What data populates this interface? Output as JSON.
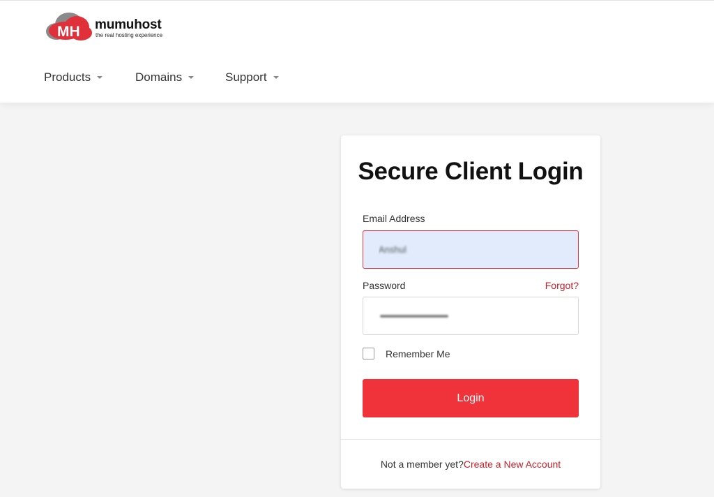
{
  "brand": {
    "logo_monogram": "MH",
    "name": "mumuhost",
    "tagline": "the real hosting experience",
    "accent_color": "#e0313a"
  },
  "nav": {
    "items": [
      {
        "label": "Products",
        "icon": "caret-down-icon"
      },
      {
        "label": "Domains",
        "icon": "caret-down-icon"
      },
      {
        "label": "Support",
        "icon": "caret-down-icon"
      }
    ]
  },
  "login": {
    "title": "Secure Client Login",
    "email_label": "Email Address",
    "email_value": "Anshul",
    "password_label": "Password",
    "forgot_label": "Forgot?",
    "remember_label": "Remember Me",
    "remember_checked": false,
    "login_button": "Login",
    "not_member_text": "Not a member yet?",
    "create_account_link": "Create a New Account",
    "button_color": "#f0323a",
    "link_color": "#c8202a"
  }
}
